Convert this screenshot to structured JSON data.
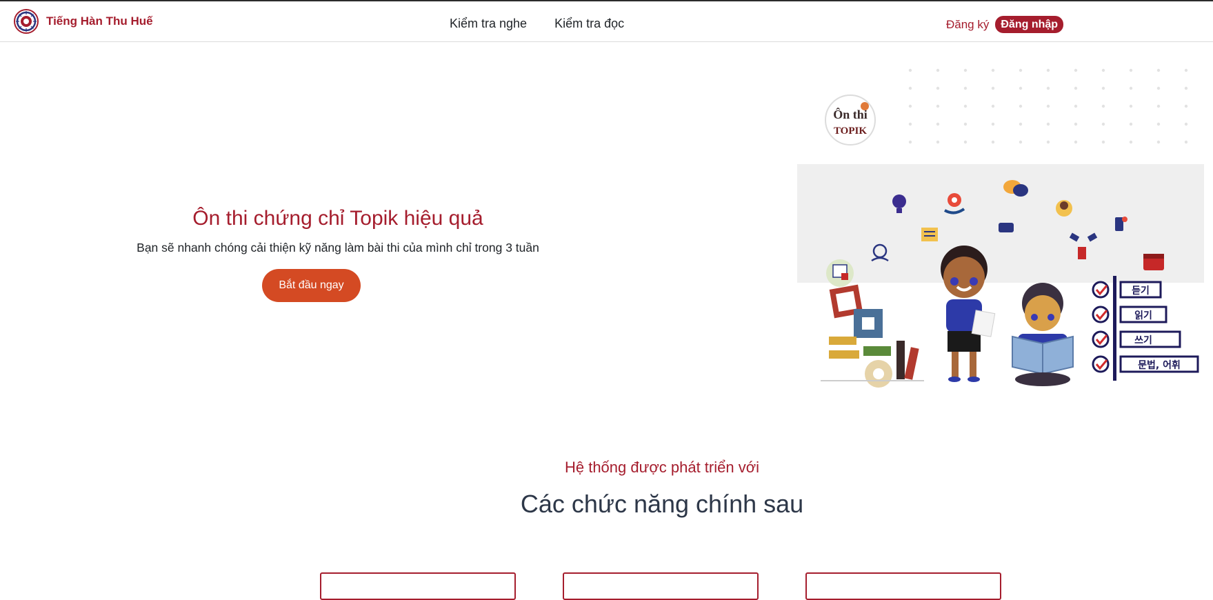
{
  "brand": {
    "name": "Tiếng Hàn Thu Huế",
    "logo_icon": "brand-emblem-icon",
    "accent_color": "#a51d2d"
  },
  "nav": {
    "links": [
      {
        "label": "Kiểm tra nghe"
      },
      {
        "label": "Kiểm tra đọc"
      }
    ]
  },
  "auth": {
    "register_label": "Đăng ký",
    "login_label": "Đăng nhập"
  },
  "hero": {
    "title": "Ôn thi chứng chỉ Topik hiệu quả",
    "subtitle": "Bạn sẽ nhanh chóng cải thiện kỹ năng làm bài thi của mình chỉ trong 3 tuần",
    "cta_label": "Bắt đầu ngay",
    "cta_color": "#d44a23",
    "illustration": {
      "badge_line1": "Ôn thi",
      "badge_line2": "TOPIK",
      "checklist": [
        "듣기",
        "읽기",
        "쓰기",
        "문법, 어휘"
      ]
    }
  },
  "features": {
    "kicker": "Hệ thống được phát triển với",
    "title": "Các chức năng chính sau",
    "card_count": 3
  }
}
